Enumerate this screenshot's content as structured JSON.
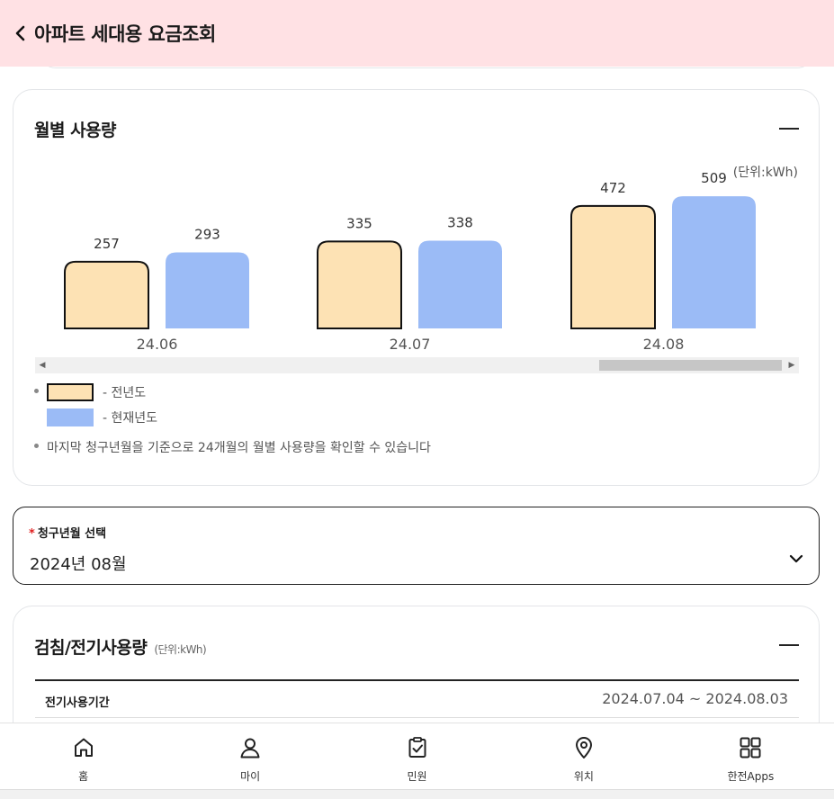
{
  "header": {
    "title": "아파트 세대용 요금조회"
  },
  "usage_card": {
    "title": "월별 사용량",
    "unit": "(단위:kWh)",
    "legend": {
      "prev_label": "- 전년도",
      "cur_label": "- 현재년도"
    },
    "note": "마지막 청구년월을 기준으로 24개월의 월별 사용량을 확인할 수 있습니다"
  },
  "chart_data": {
    "type": "bar",
    "categories": [
      "24.06",
      "24.07",
      "24.08"
    ],
    "series": [
      {
        "name": "전년도",
        "values": [
          257,
          335,
          472
        ],
        "color": "#fde2b4",
        "stroke": "#111111"
      },
      {
        "name": "현재년도",
        "values": [
          293,
          338,
          509
        ],
        "color": "#9bbbf6"
      }
    ],
    "title": "월별 사용량",
    "ylabel": "(단위:kWh)",
    "xlabel": ""
  },
  "billing_select": {
    "label": "청구년월 선택",
    "required_mark": "*",
    "value": "2024년 08월"
  },
  "meter_card": {
    "title": "검침/전기사용량",
    "unit": "(단위:kWh)",
    "rows": [
      {
        "label": "전기사용기간",
        "value": "2024.07.04 ~ 2024.08.03"
      }
    ]
  },
  "nav": {
    "items": [
      {
        "label": "홈",
        "icon": "home-icon"
      },
      {
        "label": "마이",
        "icon": "user-icon"
      },
      {
        "label": "민원",
        "icon": "clipboard-check-icon"
      },
      {
        "label": "위치",
        "icon": "location-pin-icon"
      },
      {
        "label": "한전Apps",
        "icon": "apps-grid-icon"
      }
    ]
  }
}
